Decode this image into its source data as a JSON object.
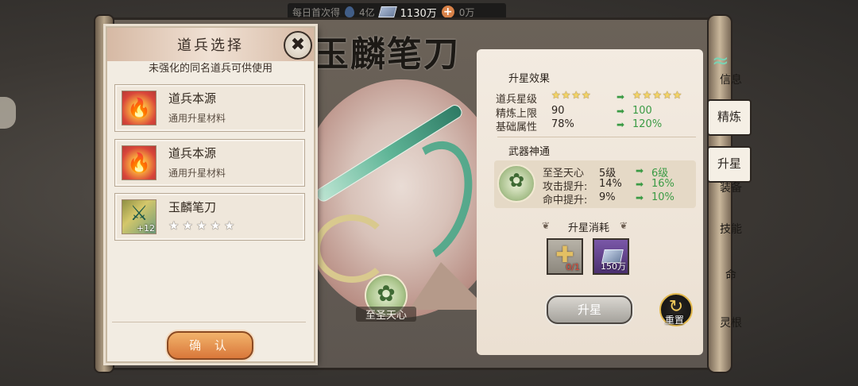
{
  "topbar": {
    "label": "每日首次得",
    "gems": "4亿",
    "ingots": "1130万",
    "coins": "0万"
  },
  "art": {
    "title": "玉麟笔刀",
    "skill_name": "至圣天心"
  },
  "dialog": {
    "title": "道兵选择",
    "subtitle": "未强化的同名道兵可供使用",
    "items": [
      {
        "name": "道兵本源",
        "desc": "通用升星材料",
        "icon": "fire-essence-icon"
      },
      {
        "name": "道兵本源",
        "desc": "通用升星材料",
        "icon": "fire-essence-icon"
      },
      {
        "name": "玉麟笔刀",
        "level": "+12",
        "stars": 5,
        "icon": "jade-blade-icon"
      }
    ],
    "confirm": "确 认",
    "close": "✖"
  },
  "info": {
    "effect_title": "升星效果",
    "rows": [
      {
        "label": "道兵星级",
        "from_stars": 4,
        "to_stars": 5
      },
      {
        "label": "精炼上限",
        "from": "90",
        "to": "100"
      },
      {
        "label": "基础属性",
        "from": "78%",
        "to": "120%"
      }
    ],
    "shentong_title": "武器神通",
    "shentong": [
      {
        "label": "至圣天心",
        "from": "5级",
        "to": "6级"
      },
      {
        "label": "攻击提升:",
        "from": "14%",
        "to": "16%"
      },
      {
        "label": "命中提升:",
        "from": "9%",
        "to": "10%"
      }
    ],
    "cost_title": "升星消耗",
    "costs": [
      {
        "icon": "gold-plus-icon",
        "count": "0/1"
      },
      {
        "icon": "silver-ingot-icon",
        "count": "150万"
      }
    ],
    "upstar_button": "升星",
    "reset_label": "重置"
  },
  "tabs": {
    "info": "信息",
    "refine": "精炼",
    "upstar": "升星",
    "skill": "技能",
    "life": "命",
    "root": "灵根",
    "equip": "装备"
  }
}
